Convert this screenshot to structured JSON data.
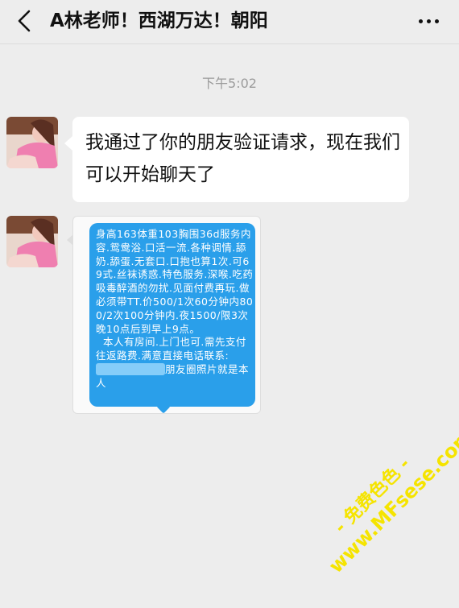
{
  "header": {
    "title": "A林老师！西湖万达！朝阳",
    "back_icon": "chevron-left-icon",
    "more_icon": "ellipsis-icon"
  },
  "chat": {
    "timestamp": "下午5:02",
    "msg1": {
      "text": "我通过了你的朋友验证请求，现在我们可以开始聊天了"
    },
    "msg2": {
      "sms_text_1": "身高163体重103胸围36d服务内容.鸳鸯浴.口活一流.各种调情.舔奶.舔蛋.无套口.口抱也算1次.可69式.丝袜诱惑.特色服务.深喉.吃药吸毒醉酒的勿扰.见面付费再玩.做必须带TT.价500/1次60分钟内800/2次100分钟内.夜1500/限3次晚10点后到早上9点。\n  本人有房间.上门也可.需先支付往返路费.满意直接电话联系:",
      "sms_text_2": "朋友圈照片就是本人"
    }
  },
  "watermark": {
    "line1": "- 免费色色 -",
    "line2": "www.MFsese.com"
  },
  "colors": {
    "background": "#ededed",
    "sms_blue": "#2a9fea",
    "watermark": "#f5e400"
  }
}
